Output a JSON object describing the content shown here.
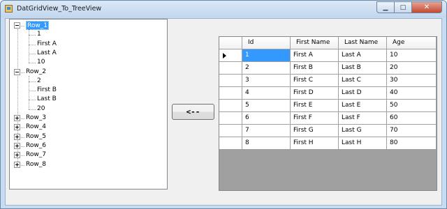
{
  "window": {
    "title": "DatGridView_To_TreeView",
    "minimize_glyph": "▁",
    "maximize_glyph": "□",
    "close_glyph": "✕"
  },
  "tree": {
    "nodes": [
      {
        "label": "Row_1",
        "expanded": true,
        "selected": true,
        "children": [
          "1",
          "First A",
          "Last A",
          "10"
        ]
      },
      {
        "label": "Row_2",
        "expanded": true,
        "selected": false,
        "children": [
          "2",
          "First B",
          "Last B",
          "20"
        ]
      },
      {
        "label": "Row_3",
        "expanded": false
      },
      {
        "label": "Row_4",
        "expanded": false
      },
      {
        "label": "Row_5",
        "expanded": false
      },
      {
        "label": "Row_6",
        "expanded": false
      },
      {
        "label": "Row_7",
        "expanded": false
      },
      {
        "label": "Row_8",
        "expanded": false
      }
    ]
  },
  "move_button": {
    "label": "<--"
  },
  "grid": {
    "columns": [
      "Id",
      "First Name",
      "Last Name",
      "Age"
    ],
    "current_row": 0,
    "rows": [
      [
        "1",
        "First A",
        "Last A",
        "10"
      ],
      [
        "2",
        "First B",
        "Last B",
        "20"
      ],
      [
        "3",
        "First C",
        "Last C",
        "30"
      ],
      [
        "4",
        "First D",
        "Last D",
        "40"
      ],
      [
        "5",
        "First E",
        "Last E",
        "50"
      ],
      [
        "6",
        "First F",
        "Last F",
        "60"
      ],
      [
        "7",
        "First G",
        "Last G",
        "70"
      ],
      [
        "8",
        "First H",
        "Last H",
        "80"
      ]
    ]
  },
  "colors": {
    "selection": "#3399ff",
    "grid_background": "#a0a0a0",
    "titlebar": "#c7dcf0"
  }
}
